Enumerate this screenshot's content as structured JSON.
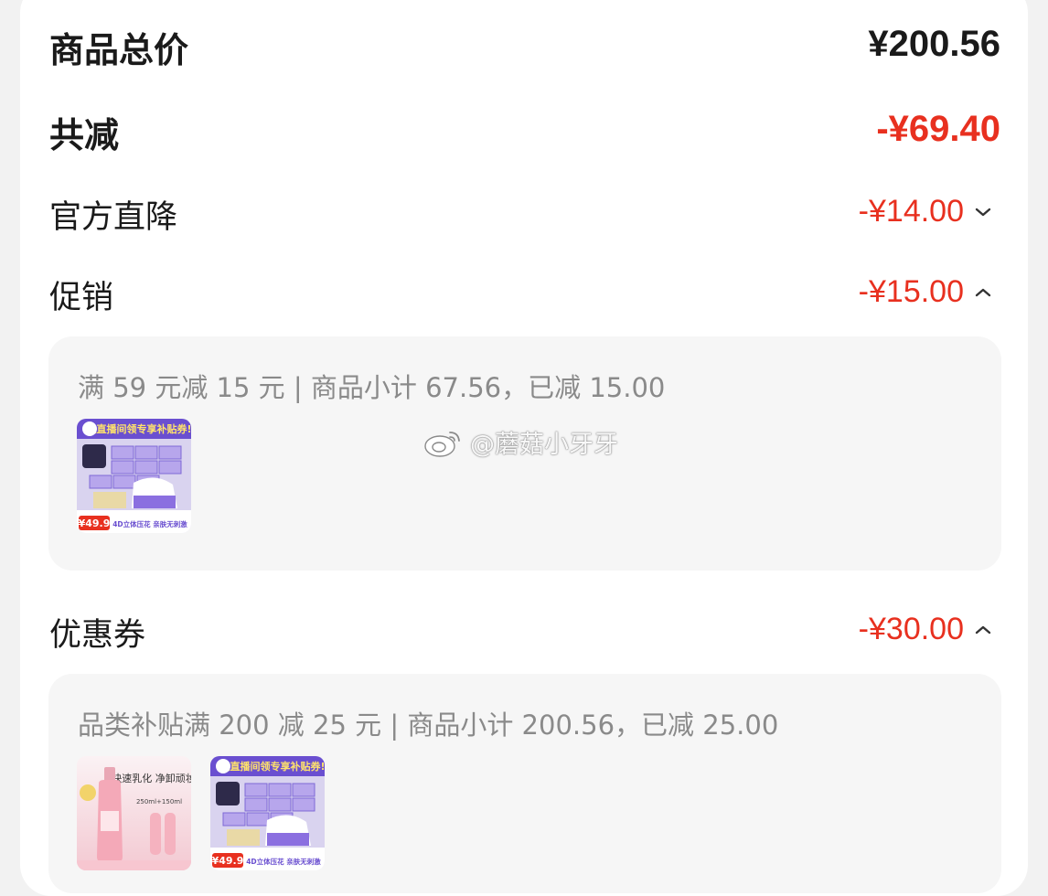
{
  "summary": {
    "total_label": "商品总价",
    "total_amount": "¥200.56",
    "reduction_label": "共减",
    "reduction_amount": "-¥69.40"
  },
  "discounts": [
    {
      "label": "官方直降",
      "amount": "-¥14.00",
      "expanded": false,
      "icon": "chevron-down-icon"
    },
    {
      "label": "促销",
      "amount": "-¥15.00",
      "expanded": true,
      "icon": "chevron-up-icon"
    },
    {
      "label": "优惠券",
      "amount": "-¥30.00",
      "expanded": true,
      "icon": "chevron-up-icon"
    }
  ],
  "promo_panel": {
    "text": "满 59 元减 15 元 | 商品小计 67.56，已减 15.00",
    "products": [
      {
        "type": "tissue-pack",
        "banner": "进直播间领专享补贴券!",
        "price": "¥49.9",
        "tagline": "4D立体压花 亲肤无刺激"
      }
    ]
  },
  "coupon_panel": {
    "text": "品类补贴满 200 减 25 元 | 商品小计 200.56，已减 25.00",
    "products": [
      {
        "type": "cleansing-oil",
        "headline": "快速乳化 净卸顽妆",
        "size": "250ml+150ml"
      },
      {
        "type": "tissue-pack",
        "banner": "进直播间领专享补贴券!",
        "price": "¥49.9",
        "tagline": "4D立体压花 亲肤无刺激"
      }
    ]
  },
  "watermark": {
    "text": "@蘑菇小牙牙",
    "icon": "weibo-icon"
  },
  "colors": {
    "accent_red": "#e8301f",
    "text_dark": "#1a1a1a",
    "text_grey": "#8a8a8a",
    "panel_bg": "#f6f6f6"
  }
}
